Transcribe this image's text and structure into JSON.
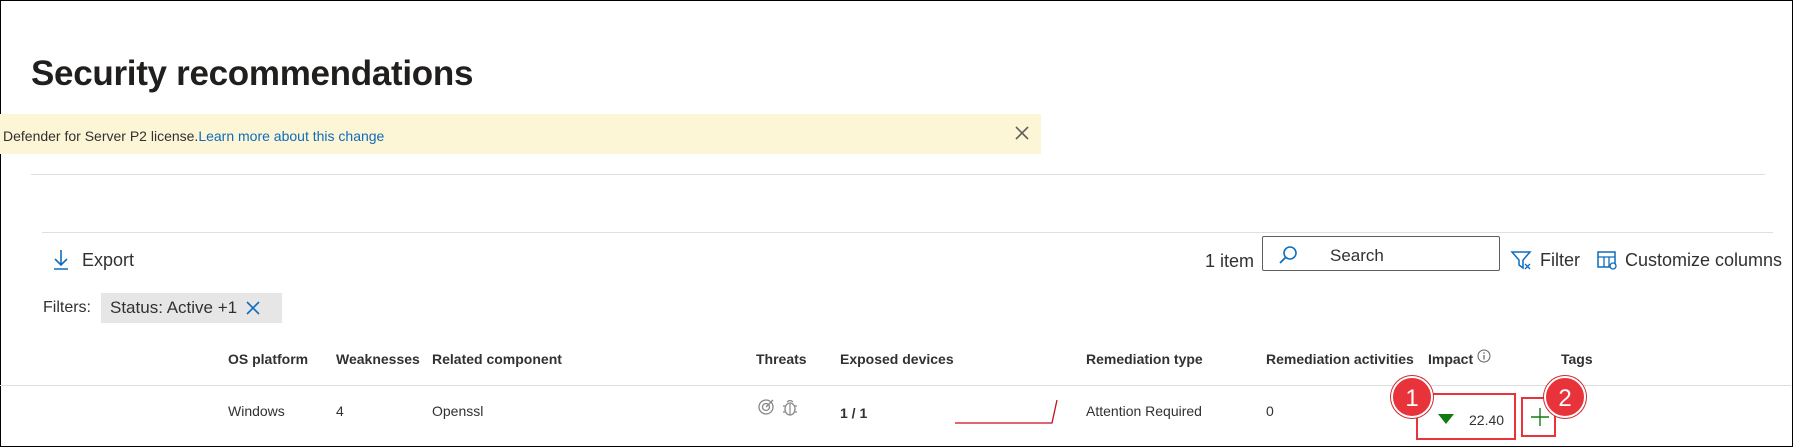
{
  "page": {
    "title": "Security recommendations"
  },
  "banner": {
    "text": "Defender for Server P2 license.",
    "link": "Learn more about this change"
  },
  "toolbar": {
    "export_label": "Export",
    "item_count": "1 item",
    "search_placeholder": "Search",
    "filter_label": "Filter",
    "customize_label": "Customize columns"
  },
  "filters": {
    "label": "Filters:",
    "chip": "Status: Active +1"
  },
  "table": {
    "headers": {
      "os_platform": "OS platform",
      "weaknesses": "Weaknesses",
      "related_component": "Related component",
      "threats": "Threats",
      "exposed_devices": "Exposed devices",
      "remediation_type": "Remediation type",
      "remediation_activities": "Remediation activities",
      "impact": "Impact",
      "tags": "Tags"
    },
    "rows": [
      {
        "os_platform": "Windows",
        "weaknesses": "4",
        "related_component": "Openssl",
        "exposed_devices": "1 / 1",
        "remediation_type": "Attention Required",
        "remediation_activities": "0",
        "impact": "22.40"
      }
    ]
  },
  "callouts": {
    "first": "1",
    "second": "2"
  },
  "colors": {
    "accent": "#0f6cbd",
    "banner_bg": "#fcf5d6",
    "callout": "#e8333a",
    "impact_arrow": "#107c10",
    "trend_line": "#c50f1f"
  }
}
